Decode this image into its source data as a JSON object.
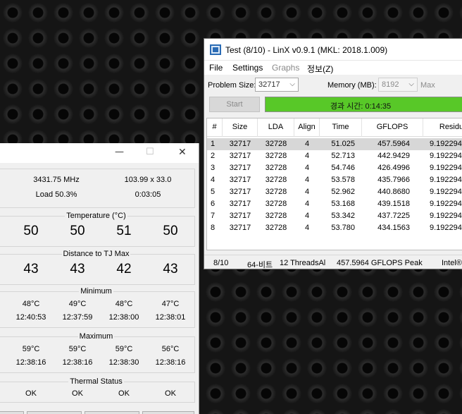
{
  "temp_monitor": {
    "caption": {
      "minimize": "—",
      "maximize": "☐",
      "close": "✕"
    },
    "frequency": "3431.75 MHz",
    "multiplier": "103.99 x 33.0",
    "load": "Load  50.3%",
    "elapsed": "0:03:05",
    "temperature": {
      "label": "Temperature (°C)",
      "values": [
        "50",
        "50",
        "51",
        "50"
      ]
    },
    "distance": {
      "label": "Distance to TJ Max",
      "values": [
        "43",
        "43",
        "42",
        "43"
      ]
    },
    "minimum": {
      "label": "Minimum",
      "temps": [
        "48°C",
        "49°C",
        "48°C",
        "47°C"
      ],
      "times": [
        "12:40:53",
        "12:37:59",
        "12:38:00",
        "12:38:01"
      ]
    },
    "maximum": {
      "label": "Maximum",
      "temps": [
        "59°C",
        "59°C",
        "59°C",
        "56°C"
      ],
      "times": [
        "12:38:16",
        "12:38:16",
        "12:38:30",
        "12:38:16"
      ]
    },
    "thermal": {
      "label": "Thermal Status",
      "values": [
        "OK",
        "OK",
        "OK",
        "OK"
      ]
    }
  },
  "linx": {
    "title": "Test (8/10) - LinX v0.9.1 (MKL: 2018.1.009)",
    "menu": [
      "File",
      "Settings",
      "Graphs",
      "정보(Z)"
    ],
    "problem_size_label": "Problem Size:",
    "problem_size_value": "32717",
    "memory_label": "Memory (MB):",
    "memory_value": "8192",
    "max_label": "Max",
    "start_label": "Start",
    "progress": {
      "text": "경과 시간: 0:14:35",
      "fraction": 1.0,
      "color": "#58c828"
    },
    "table": {
      "headers": [
        "#",
        "Size",
        "LDA",
        "Align",
        "Time",
        "GFLOPS",
        "Residu"
      ],
      "rows": [
        [
          "1",
          "32717",
          "32728",
          "4",
          "51.025",
          "457.5964",
          "9.192294"
        ],
        [
          "2",
          "32717",
          "32728",
          "4",
          "52.713",
          "442.9429",
          "9.192294"
        ],
        [
          "3",
          "32717",
          "32728",
          "4",
          "54.746",
          "426.4996",
          "9.192294"
        ],
        [
          "4",
          "32717",
          "32728",
          "4",
          "53.578",
          "435.7966",
          "9.192294"
        ],
        [
          "5",
          "32717",
          "32728",
          "4",
          "52.962",
          "440.8680",
          "9.192294"
        ],
        [
          "6",
          "32717",
          "32728",
          "4",
          "53.168",
          "439.1518",
          "9.192294"
        ],
        [
          "7",
          "32717",
          "32728",
          "4",
          "53.342",
          "437.7225",
          "9.192294"
        ],
        [
          "8",
          "32717",
          "32728",
          "4",
          "53.780",
          "434.1563",
          "9.192294"
        ]
      ]
    },
    "status": {
      "progress": "8/10",
      "bits": "64-비트",
      "threads": "12 ThreadsAl",
      "peak": "457.5964 GFLOPS Peak",
      "cpu": "Intel®"
    }
  }
}
